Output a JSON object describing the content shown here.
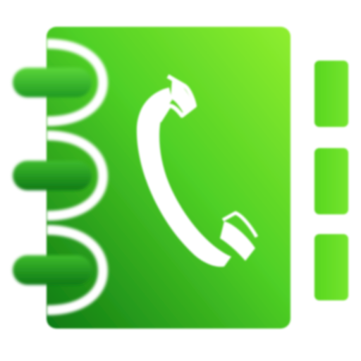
{
  "icon": {
    "name": "phone-book-icon",
    "colors": {
      "book_light": "#8fee2e",
      "book_mid": "#3cc31f",
      "book_dark": "#0e7a14",
      "ring_light": "#52cc34",
      "ring_dark": "#0f7a16",
      "tab": "#5fdc24",
      "handset": "#ffffff",
      "background": "#ffffff"
    },
    "binder_rings": 3,
    "index_tabs": 3
  }
}
